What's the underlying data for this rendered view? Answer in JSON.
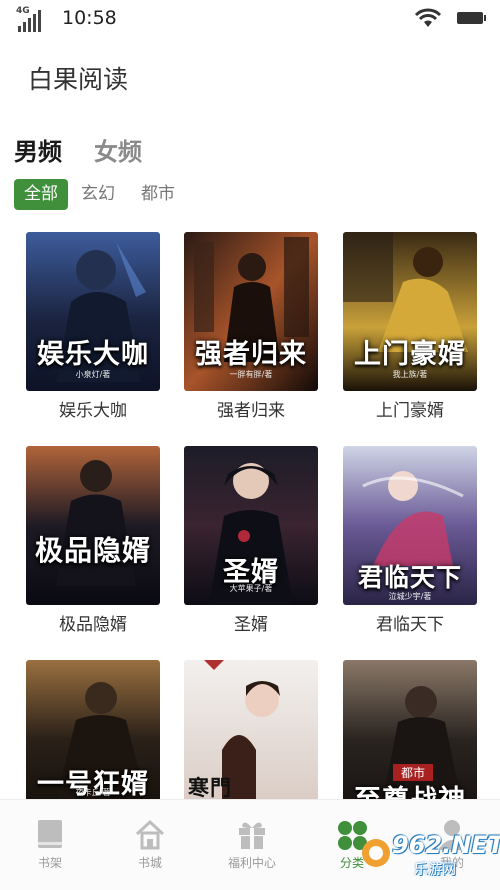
{
  "status_bar": {
    "network": "4G",
    "time": "10:58"
  },
  "app": {
    "title": "白果阅读"
  },
  "gender_tabs": [
    {
      "label": "男频",
      "active": true
    },
    {
      "label": "女频",
      "active": false
    }
  ],
  "categories": [
    {
      "label": "全部",
      "active": true
    },
    {
      "label": "玄幻",
      "active": false
    },
    {
      "label": "都市",
      "active": false
    }
  ],
  "books": [
    {
      "name": "娱乐大咖",
      "cover_title": "娱乐大咖",
      "cover_author": "小泉灯/著",
      "palette": [
        "#1b2440",
        "#3d5c9c",
        "#0d1226"
      ]
    },
    {
      "name": "强者归来",
      "cover_title": "强者归来",
      "cover_author": "一胖有胖/著",
      "palette": [
        "#2a1a14",
        "#a8542a",
        "#120a08"
      ]
    },
    {
      "name": "上门豪婿",
      "cover_title": "上门豪婿",
      "cover_author": "我上族/著",
      "palette": [
        "#3a2a14",
        "#c9a13a",
        "#1a1208"
      ]
    },
    {
      "name": "极品隐婿",
      "cover_title": "极品隐婿",
      "cover_author": "",
      "palette": [
        "#1e1a24",
        "#b1643a",
        "#0a0a12"
      ]
    },
    {
      "name": "圣婿",
      "cover_title": "圣婿",
      "cover_author": "大苹果子/著",
      "palette": [
        "#1c1c28",
        "#6e3040",
        "#0c0c14"
      ]
    },
    {
      "name": "君临天下",
      "cover_title": "君临天下",
      "cover_author": "泣城少宇/著",
      "palette": [
        "#cfd4e6",
        "#c83a6a",
        "#6a5a96"
      ]
    },
    {
      "name": "",
      "cover_title": "一号狂婿",
      "cover_author": "夜卡丘/著",
      "palette": [
        "#2a2018",
        "#9a7040",
        "#120e0a"
      ]
    },
    {
      "name": "",
      "cover_title": "寒門",
      "cover_author": "",
      "palette": [
        "#e8e6e4",
        "#d8c8c0",
        "#b03030"
      ]
    },
    {
      "name": "",
      "cover_title": "至尊战神",
      "cover_author": "都市",
      "palette": [
        "#2a2420",
        "#8a7868",
        "#3a1a14"
      ]
    }
  ],
  "bottom_nav": [
    {
      "label": "书架",
      "icon": "book-icon",
      "active": false
    },
    {
      "label": "书城",
      "icon": "home-icon",
      "active": false
    },
    {
      "label": "福利中心",
      "icon": "gift-icon",
      "active": false
    },
    {
      "label": "分类",
      "icon": "category-icon",
      "active": true
    },
    {
      "label": "我的",
      "icon": "profile-icon",
      "active": false
    }
  ],
  "watermark": {
    "main": "962.NET",
    "sub": "乐游网"
  },
  "colors": {
    "accent": "#3f8f3b",
    "inactive": "#9a9a9a"
  }
}
